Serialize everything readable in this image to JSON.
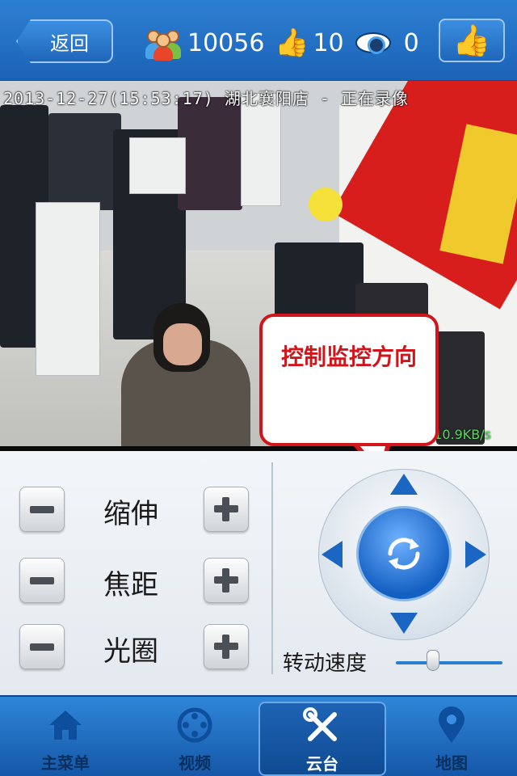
{
  "header": {
    "back_label": "返回",
    "viewer_count": "10056",
    "like_count": "10",
    "view_count": "0"
  },
  "video": {
    "osd_text": "2013-12-27(15:53:17) 湖北襄阳店 - 正在录像",
    "bitrate": "10.9KB/s"
  },
  "tooltip": {
    "text": "控制监控方向"
  },
  "controls": {
    "rows": [
      {
        "label": "缩伸"
      },
      {
        "label": "焦距"
      },
      {
        "label": "光圈"
      }
    ],
    "speed_label": "转动速度",
    "speed_value": 0.35
  },
  "tabs": [
    {
      "label": "主菜单",
      "icon": "home-icon"
    },
    {
      "label": "视频",
      "icon": "video-icon"
    },
    {
      "label": "云台",
      "icon": "tools-icon"
    },
    {
      "label": "地图",
      "icon": "map-pin-icon"
    }
  ],
  "colors": {
    "accent": "#1b63b7",
    "tooltip_red": "#d2141b"
  }
}
